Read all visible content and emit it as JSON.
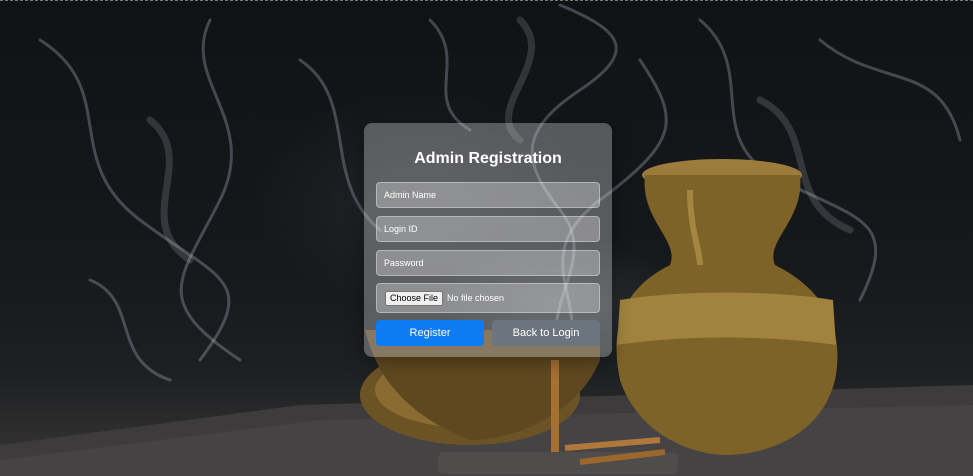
{
  "form": {
    "title": "Admin Registration",
    "admin_name_placeholder": "Admin Name",
    "login_id_placeholder": "Login ID",
    "password_placeholder": "Password",
    "file_button_label": "Choose File",
    "file_status": "No file chosen",
    "register_label": "Register",
    "back_label": "Back to Login"
  },
  "colors": {
    "primary_button": "#0d7bf2",
    "secondary_button": "#6c757d"
  }
}
